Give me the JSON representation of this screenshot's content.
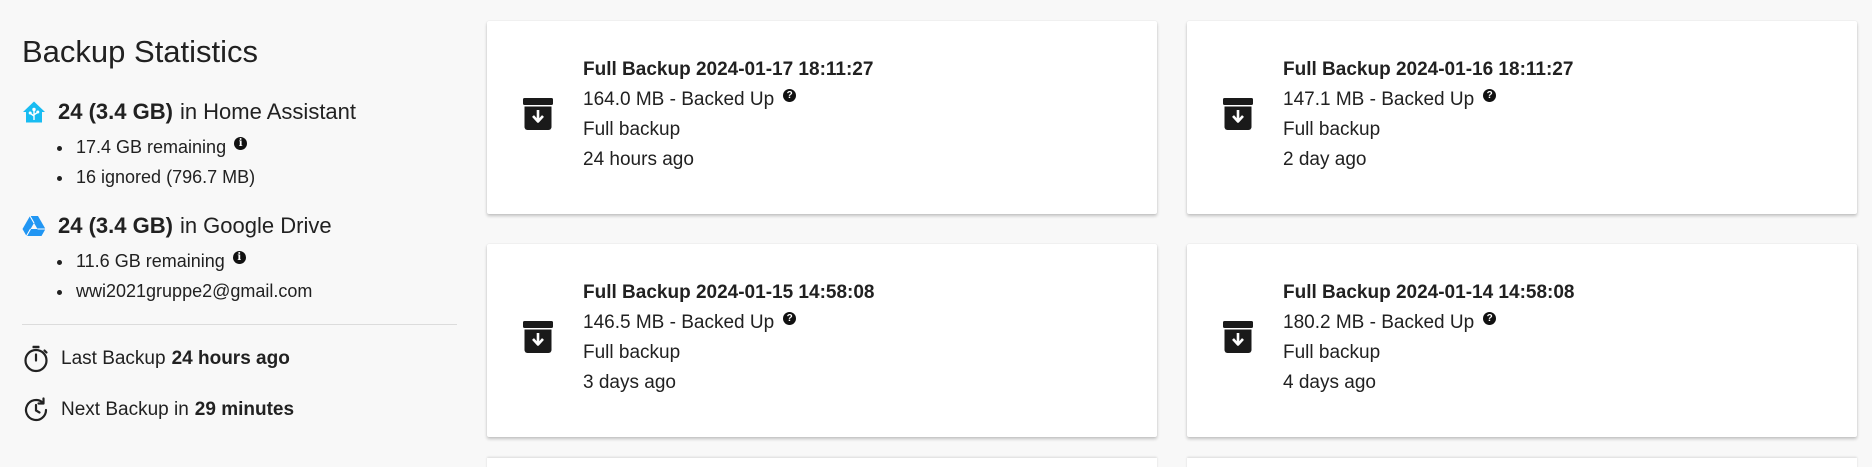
{
  "sidebar": {
    "title": "Backup Statistics",
    "home_assistant": {
      "icon": "home-assistant-icon",
      "count": "24 (3.4 GB)",
      "location": "in Home Assistant",
      "remaining": "17.4 GB remaining",
      "ignored": "16 ignored (796.7 MB)"
    },
    "google_drive": {
      "icon": "google-drive-icon",
      "count": "24 (3.4 GB)",
      "location": "in Google Drive",
      "remaining": "11.6 GB remaining",
      "account": "wwi2021gruppe2@gmail.com"
    },
    "last_backup": {
      "icon": "timer-icon",
      "label": "Last Backup",
      "value": "24 hours ago"
    },
    "next_backup": {
      "icon": "clock-refresh-icon",
      "label": "Next Backup in",
      "value": "29 minutes"
    }
  },
  "backups": [
    {
      "title": "Full Backup 2024-01-17 18:11:27",
      "size_status": "164.0 MB - Backed Up",
      "type": "Full backup",
      "age": "24 hours ago"
    },
    {
      "title": "Full Backup 2024-01-16 18:11:27",
      "size_status": "147.1 MB - Backed Up",
      "type": "Full backup",
      "age": "2 day ago"
    },
    {
      "title": "Full Backup 2024-01-15 14:58:08",
      "size_status": "146.5 MB - Backed Up",
      "type": "Full backup",
      "age": "3 days ago"
    },
    {
      "title": "Full Backup 2024-01-14 14:58:08",
      "size_status": "180.2 MB - Backed Up",
      "type": "Full backup",
      "age": "4 days ago"
    }
  ],
  "colors": {
    "home_assistant_blue": "#18BCF2",
    "google_drive_blue": "#2196F3",
    "background": "#f8f8f8",
    "card": "#ffffff",
    "text": "#212121"
  }
}
